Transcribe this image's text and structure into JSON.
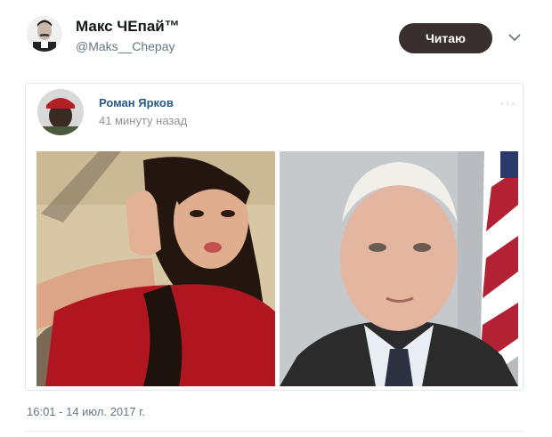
{
  "author": {
    "name": "Макс ЧЕпай™",
    "handle": "@Maks__Chepay"
  },
  "follow_button": {
    "label": "Читаю"
  },
  "embedded_post": {
    "author": "Роман Ярков",
    "time": "41 минуту назад",
    "menu_icon": "···",
    "photos": [
      "photo-woman-red-top",
      "photo-older-man-suit-flag"
    ]
  },
  "tweet": {
    "timestamp": "16:01 - 14 июл. 2017 г."
  },
  "colors": {
    "follow_button_bg": "#3a2f2f",
    "post_author_link": "#2a5885",
    "muted_text": "#657786"
  }
}
